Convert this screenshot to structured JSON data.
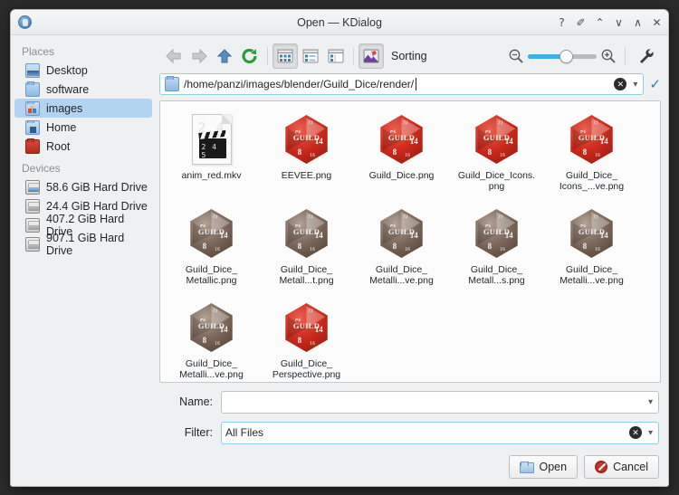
{
  "window": {
    "title": "Open — KDialog",
    "app_icon": "kdialog-icon",
    "buttons": [
      {
        "name": "help-button",
        "glyph": "?"
      },
      {
        "name": "pin-button",
        "glyph": "✐"
      },
      {
        "name": "shade-button",
        "glyph": "⌃"
      },
      {
        "name": "minimize-button",
        "glyph": "∨"
      },
      {
        "name": "maximize-button",
        "glyph": "∧"
      },
      {
        "name": "close-button",
        "glyph": "✕"
      }
    ]
  },
  "sidebar": {
    "places_title": "Places",
    "places": [
      {
        "label": "Desktop",
        "icon": "desktop-icon",
        "selected": false
      },
      {
        "label": "software",
        "icon": "folder-icon",
        "selected": false
      },
      {
        "label": "images",
        "icon": "images-folder-icon",
        "selected": true
      },
      {
        "label": "Home",
        "icon": "home-folder-icon",
        "selected": false
      },
      {
        "label": "Root",
        "icon": "root-folder-icon",
        "selected": false
      }
    ],
    "devices_title": "Devices",
    "devices": [
      {
        "label": "58.6 GiB Hard Drive",
        "icon": "hard-drive-icon",
        "mounted": true
      },
      {
        "label": "24.4 GiB Hard Drive",
        "icon": "hard-drive-icon",
        "mounted": false
      },
      {
        "label": "407.2 GiB Hard Drive",
        "icon": "hard-drive-icon",
        "mounted": false
      },
      {
        "label": "907.1 GiB Hard Drive",
        "icon": "hard-drive-icon",
        "mounted": false
      }
    ]
  },
  "toolbar": {
    "back": "back-icon",
    "forward": "forward-icon",
    "up": "up-icon",
    "reload": "reload-icon",
    "icon_view": "icon-view-icon",
    "compact_view": "compact-view-icon",
    "detail_view": "detail-view-icon",
    "preview": "preview-icon",
    "sorting_label": "Sorting",
    "zoom_out": "zoom-out-icon",
    "zoom_in": "zoom-in-icon",
    "zoom_percent": 55,
    "configure": "wrench-icon"
  },
  "location": {
    "icon": "folder-icon",
    "path": "/home/panzi/images/blender/Guild_Dice/render/",
    "clear_icon": "clear-icon",
    "dropdown_icon": "chevron-down-icon",
    "confirm_icon": "checkmark-icon",
    "accent": "#3daee9"
  },
  "files": [
    {
      "name": "anim_red.mkv",
      "thumb": "video-file",
      "label_lines": [
        "anim_red.mkv"
      ]
    },
    {
      "name": "EEVEE.png",
      "thumb": "d20-red",
      "label_lines": [
        "EEVEE.png"
      ]
    },
    {
      "name": "Guild_Dice.png",
      "thumb": "d20-red",
      "label_lines": [
        "Guild_Dice.png"
      ]
    },
    {
      "name": "Guild_Dice_Icons.png",
      "thumb": "d20-red",
      "label_lines": [
        "Guild_Dice_Icons.",
        "png"
      ]
    },
    {
      "name": "Guild_Dice_Icons_...ve.png",
      "thumb": "d20-red",
      "label_lines": [
        "Guild_Dice_",
        "Icons_...ve.png"
      ]
    },
    {
      "name": "Guild_Dice_Metallic.png",
      "thumb": "d20-bronze",
      "label_lines": [
        "Guild_Dice_",
        "Metallic.png"
      ]
    },
    {
      "name": "Guild_Dice_Metall...t.png",
      "thumb": "d20-bronze",
      "label_lines": [
        "Guild_Dice_",
        "Metall...t.png"
      ]
    },
    {
      "name": "Guild_Dice_Metalli...ve.png",
      "thumb": "d20-bronze",
      "label_lines": [
        "Guild_Dice_",
        "Metalli...ve.png"
      ]
    },
    {
      "name": "Guild_Dice_Metall...s.png",
      "thumb": "d20-bronze",
      "label_lines": [
        "Guild_Dice_",
        "Metall...s.png"
      ]
    },
    {
      "name": "Guild_Dice_Metalli...ve.png",
      "thumb": "d20-bronze",
      "label_lines": [
        "Guild_Dice_",
        "Metalli...ve.png"
      ]
    },
    {
      "name": "Guild_Dice_Metalli...ve.png",
      "thumb": "d20-bronze",
      "label_lines": [
        "Guild_Dice_",
        "Metalli...ve.png"
      ]
    },
    {
      "name": "Guild_Dice_Perspective.png",
      "thumb": "d20-red",
      "label_lines": [
        "Guild_Dice_",
        "Perspective.png"
      ]
    }
  ],
  "dice_faces": {
    "guild": "GUILD",
    "n1": "2",
    "n2": "14",
    "n3": "8",
    "n4": "11",
    "n5": "16"
  },
  "form": {
    "name_label": "Name:",
    "name_value": "",
    "filter_label": "Filter:",
    "filter_value": "All Files"
  },
  "actions": {
    "open_label": "Open",
    "open_icon": "open-folder-icon",
    "cancel_label": "Cancel",
    "cancel_icon": "cancel-icon"
  }
}
